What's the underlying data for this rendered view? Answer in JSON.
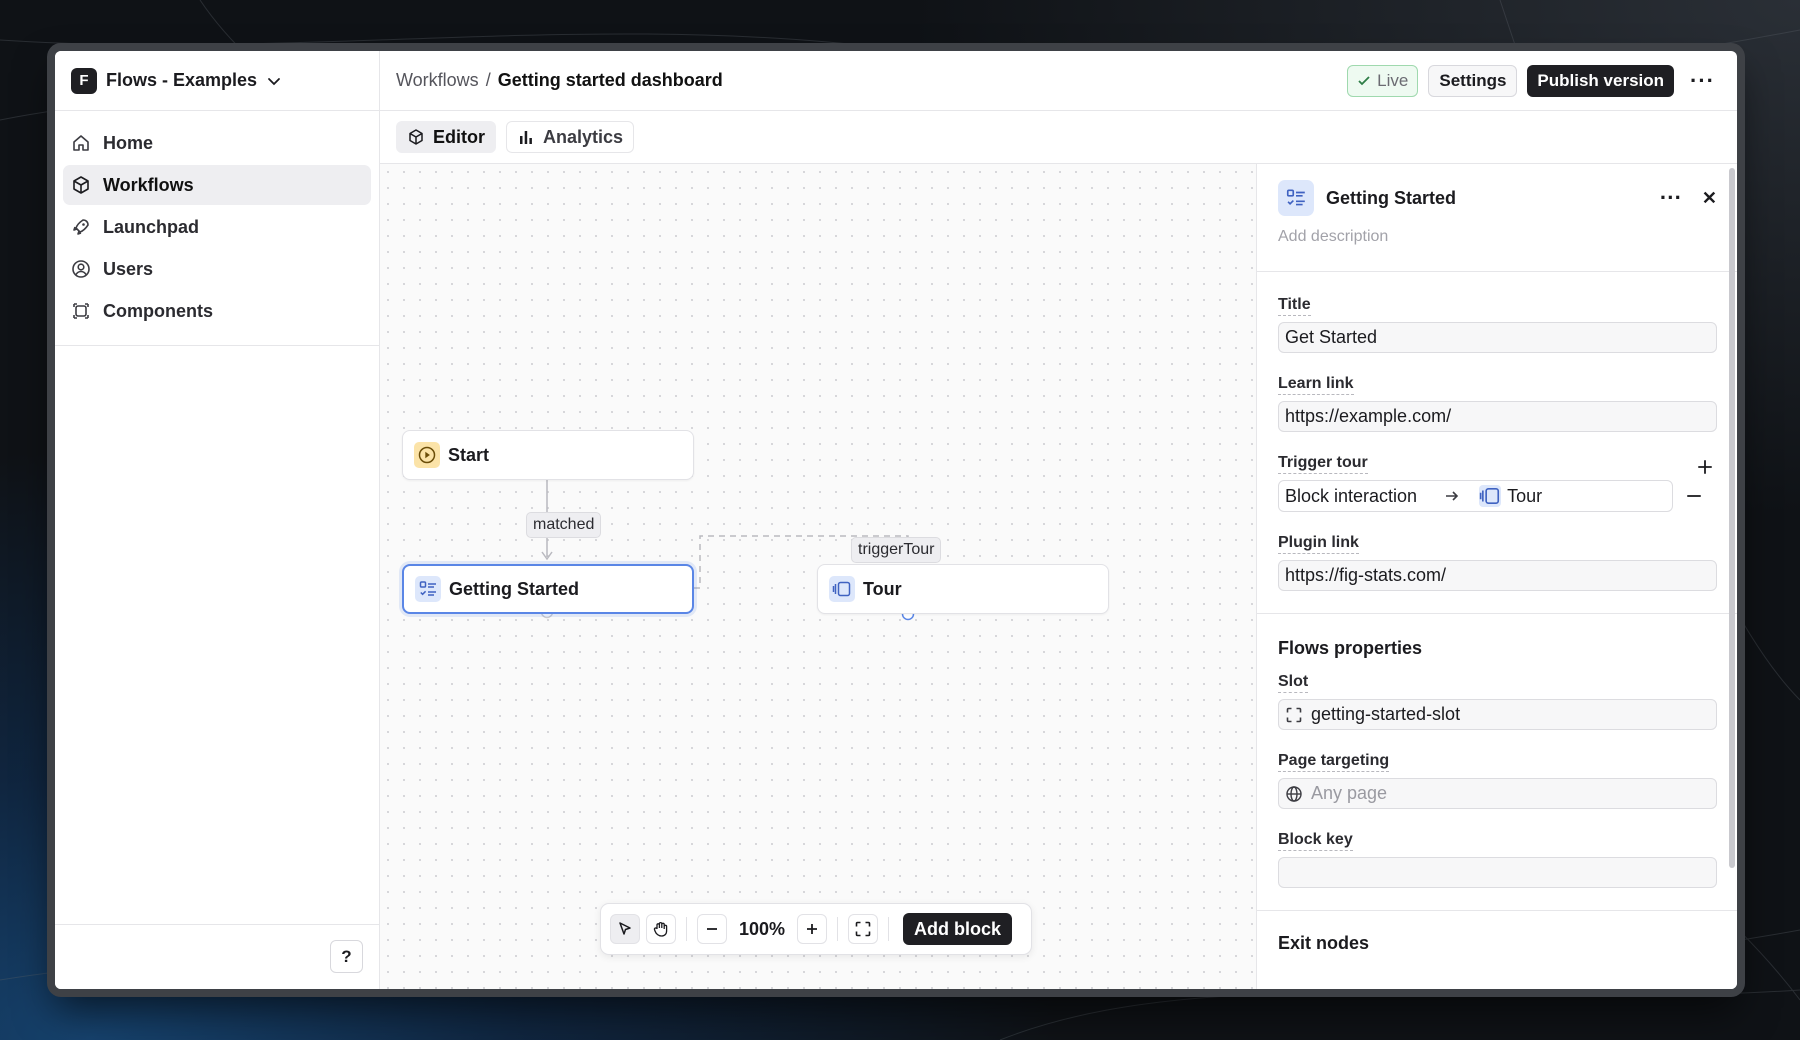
{
  "org": {
    "badge": "F",
    "name": "Flows - Examples"
  },
  "sidebar": {
    "items": [
      {
        "label": "Home",
        "icon": "home-icon",
        "active": false
      },
      {
        "label": "Workflows",
        "icon": "workflows-icon",
        "active": true
      },
      {
        "label": "Launchpad",
        "icon": "rocket-icon",
        "active": false
      },
      {
        "label": "Users",
        "icon": "user-circle-icon",
        "active": false
      },
      {
        "label": "Components",
        "icon": "components-icon",
        "active": false
      }
    ],
    "help_label": "?"
  },
  "breadcrumb": {
    "parent": "Workflows",
    "separator": "/",
    "current": "Getting started dashboard"
  },
  "top_actions": {
    "live_label": "Live",
    "settings_label": "Settings",
    "publish_label": "Publish version",
    "more_label": "···"
  },
  "tabs": [
    {
      "label": "Editor",
      "active": true
    },
    {
      "label": "Analytics",
      "active": false
    }
  ],
  "canvas": {
    "nodes": {
      "start": {
        "label": "Start"
      },
      "getting_started": {
        "label": "Getting Started"
      },
      "tour": {
        "label": "Tour"
      }
    },
    "edge_labels": {
      "matched": "matched",
      "trigger": "triggerTour"
    },
    "toolbar": {
      "zoom": "100%",
      "add_block": "Add block"
    }
  },
  "panel": {
    "title": "Getting Started",
    "description_placeholder": "Add description",
    "more_label": "···",
    "close_label": "✕",
    "fields": {
      "title": {
        "label": "Title",
        "value": "Get Started"
      },
      "learn_link": {
        "label": "Learn link",
        "value": "https://example.com/"
      },
      "trigger_tour": {
        "label": "Trigger tour",
        "source": "Block interaction",
        "target": "Tour"
      },
      "plugin_link": {
        "label": "Plugin link",
        "value": "https://fig-stats.com/"
      }
    },
    "flows_properties": {
      "title": "Flows properties",
      "slot": {
        "label": "Slot",
        "value": "getting-started-slot"
      },
      "page_targeting": {
        "label": "Page targeting",
        "placeholder": "Any page"
      },
      "block_key": {
        "label": "Block key",
        "value": ""
      }
    },
    "cut_off_label": "Exit nodes"
  },
  "colors": {
    "accent": "#5a86e6",
    "dark": "#1f1f23",
    "live_green": "#2d7d46"
  }
}
